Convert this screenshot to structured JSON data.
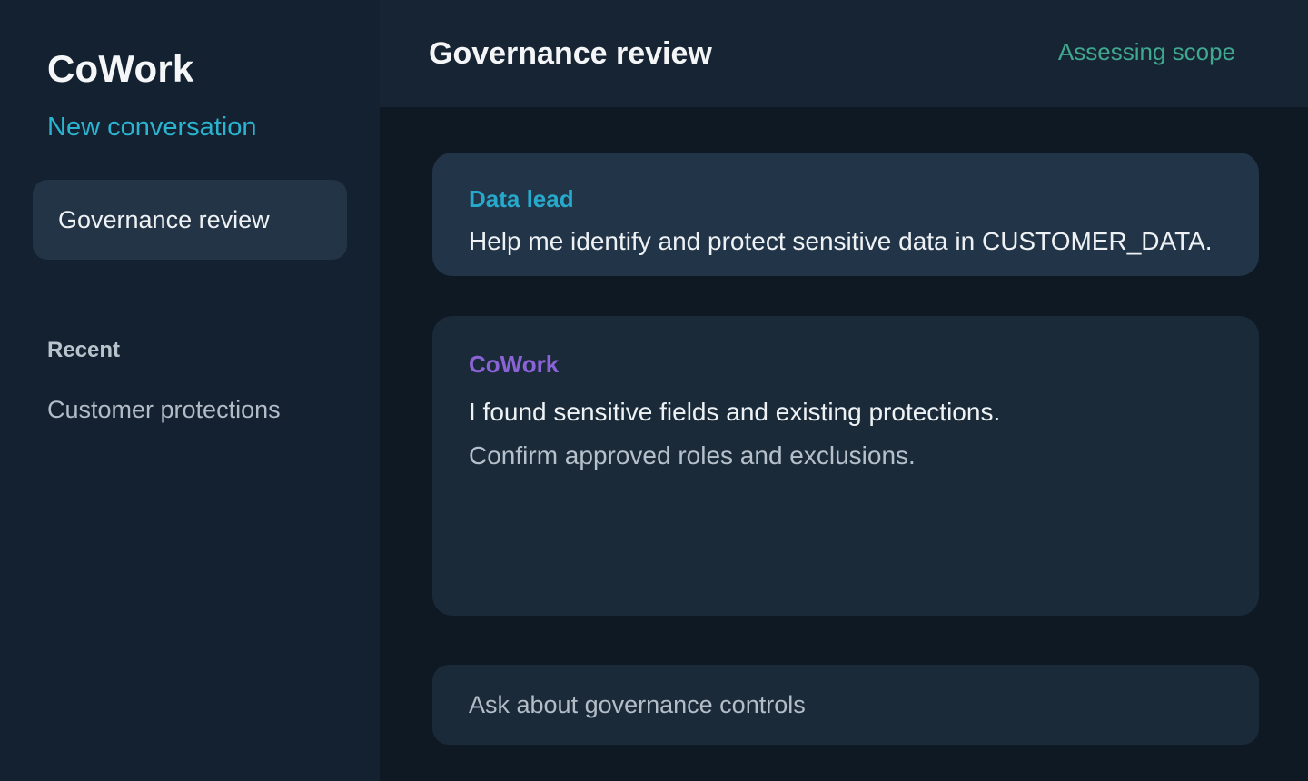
{
  "app": {
    "name": "CoWork"
  },
  "sidebar": {
    "new_conversation_label": "New conversation",
    "active_conversation": "Governance review",
    "recent_heading": "Recent",
    "recent_items": [
      {
        "label": "Customer protections"
      }
    ]
  },
  "header": {
    "title": "Governance review",
    "status": "Assessing scope"
  },
  "messages": [
    {
      "sender": "Data lead",
      "lines": [
        "Help me identify and protect sensitive data in CUSTOMER_DATA."
      ]
    },
    {
      "sender": "CoWork",
      "lines": [
        "I found sensitive fields and existing protections.",
        "Confirm approved roles and exclusions."
      ]
    }
  ],
  "composer": {
    "placeholder": "Ask about governance controls",
    "value": ""
  },
  "colors": {
    "background": "#0f1923",
    "sidebar": "#132130",
    "accent_link": "#2bb3cf",
    "status": "#3fa88e",
    "user_sender": "#27a9cc",
    "assistant_sender": "#8a63d8"
  }
}
